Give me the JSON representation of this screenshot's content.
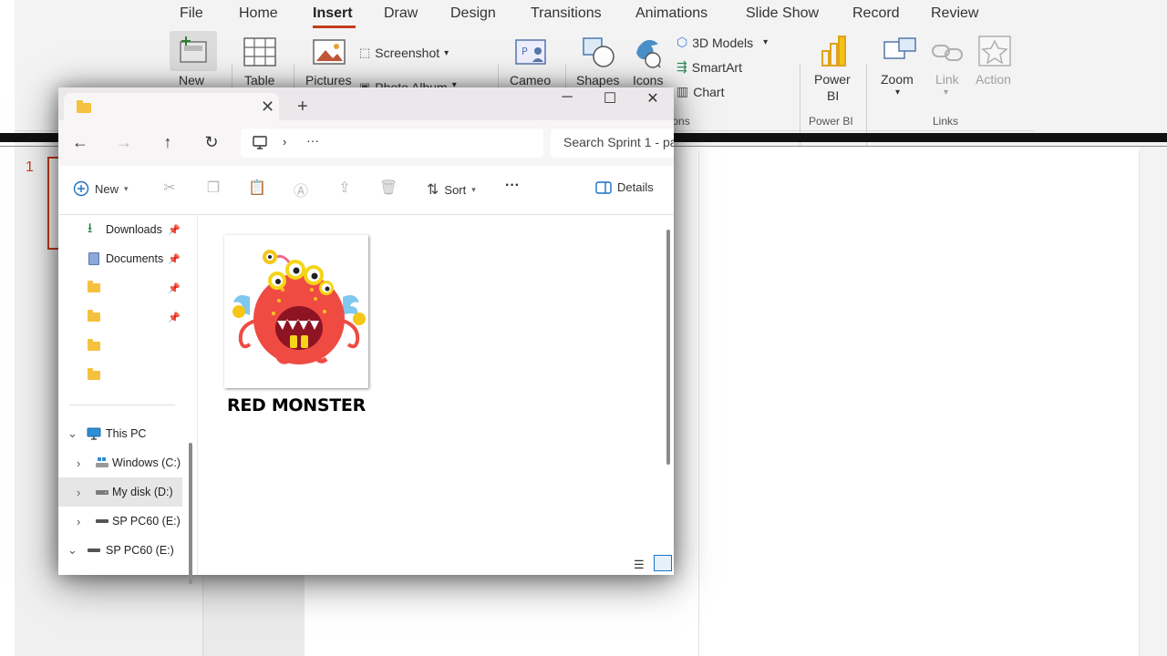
{
  "ppt": {
    "menu": [
      "File",
      "Home",
      "Insert",
      "Draw",
      "Design",
      "Transitions",
      "Animations",
      "Slide Show",
      "Record",
      "Review"
    ],
    "active_menu": "Insert",
    "ribbon": {
      "new_label": "New",
      "table_label": "Table",
      "pictures_label": "Pictures",
      "screenshot_label": "Screenshot",
      "photo_album_label": "Photo Album",
      "cameo_label": "Cameo",
      "shapes_label": "Shapes",
      "icons_label": "Icons",
      "models_label": "3D Models",
      "smartart_label": "SmartArt",
      "chart_label": "Chart",
      "illustrations_label": "Illustrations",
      "powerbi_label_line1": "Power",
      "powerbi_label_line2": "BI",
      "powerbi_group_label": "Power BI",
      "zoom_label": "Zoom",
      "link_label": "Link",
      "action_label": "Action",
      "links_group_label": "Links"
    },
    "slide_number": "1",
    "accent": "#c43e1c"
  },
  "explorer": {
    "tab_close": "✕",
    "new_tab": "+",
    "window_controls": {
      "minimize": "─",
      "maximize": "☐",
      "close": "✕"
    },
    "search_placeholder": "Search Sprint 1 - pa",
    "address_more": "···",
    "commands": {
      "new_label": "New",
      "sort_label": "Sort",
      "more_label": "···",
      "details_label": "Details"
    },
    "nav_pane": {
      "quick_access": [
        {
          "label": "Downloads",
          "icon": "download-icon"
        },
        {
          "label": "Documents",
          "icon": "documents-icon"
        },
        {
          "label": "",
          "icon": "folder-icon"
        },
        {
          "label": "",
          "icon": "folder-icon"
        },
        {
          "label": "",
          "icon": "folder-icon"
        },
        {
          "label": "",
          "icon": "folder-icon"
        }
      ],
      "this_pc": "This PC",
      "drives": [
        {
          "label": "Windows (C:)",
          "icon": "drive-c-icon"
        },
        {
          "label": "My disk (D:)",
          "icon": "drive-icon",
          "selected": true
        },
        {
          "label": "SP PC60 (E:)",
          "icon": "usb-drive-icon"
        }
      ],
      "usb_root": "SP PC60 (E:)"
    },
    "files": [
      {
        "name": "RED MONSTER",
        "type": "image",
        "icon": "red-monster-thumbnail"
      }
    ]
  }
}
